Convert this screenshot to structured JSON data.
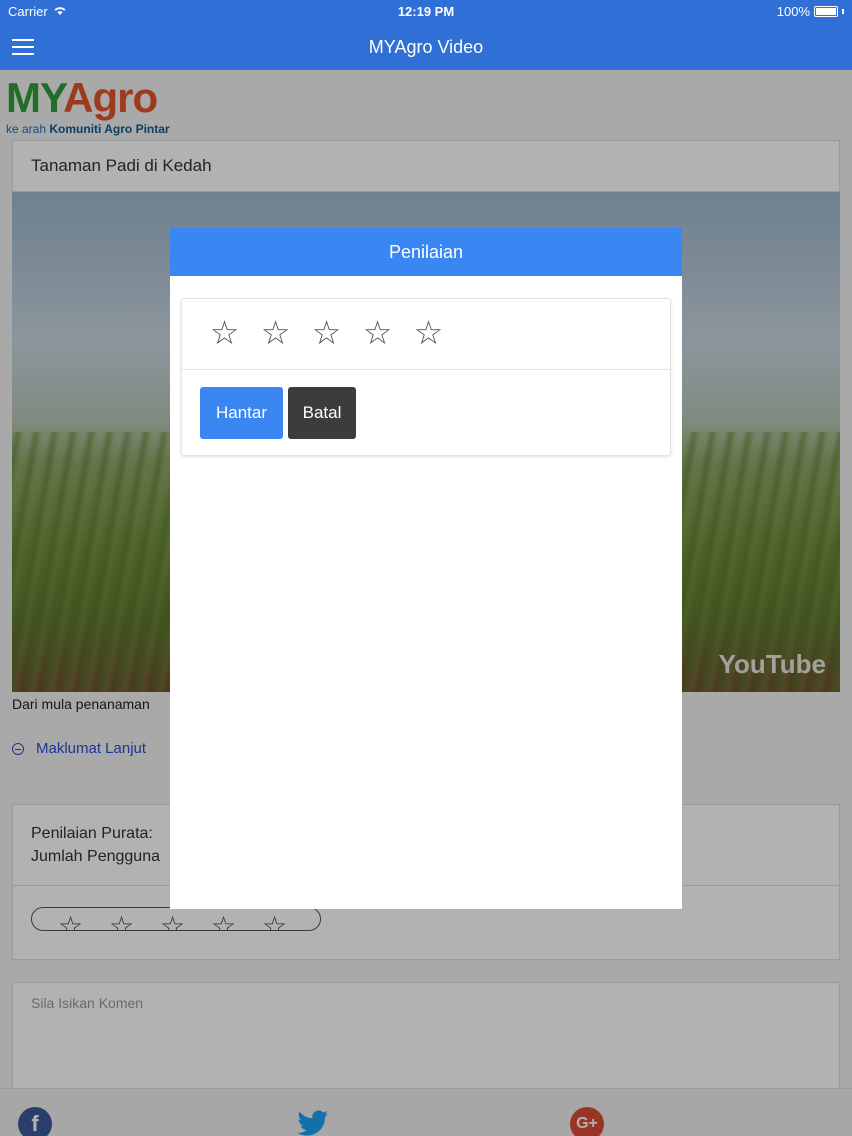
{
  "status_bar": {
    "carrier": "Carrier",
    "time": "12:19 PM",
    "battery": "100%"
  },
  "nav": {
    "title": "MYAgro Video"
  },
  "logo": {
    "my": "MY",
    "agro": "Agro",
    "tagline_prefix": "ke arah",
    "tagline_bold": "Komuniti Agro Pintar"
  },
  "video": {
    "title": "Tanaman Padi di Kedah",
    "description": "Dari mula penanaman",
    "watermark": "YouTube"
  },
  "more_info": {
    "label": "Maklumat Lanjut"
  },
  "rating_summary": {
    "average_label": "Penilaian Purata: ",
    "users_label": "Jumlah Pengguna"
  },
  "comment": {
    "placeholder": "Sila Isikan Komen"
  },
  "modal": {
    "title": "Penilaian",
    "rating": 0,
    "max_rating": 5,
    "star_glyph": "☆",
    "submit_label": "Hantar",
    "cancel_label": "Batal"
  },
  "colors": {
    "accent": "#3a86f2",
    "nav": "#2f6fd6",
    "cancel": "#3c3c3c"
  },
  "share": {
    "icons": [
      "facebook-icon",
      "twitter-icon",
      "google-plus-icon"
    ]
  }
}
